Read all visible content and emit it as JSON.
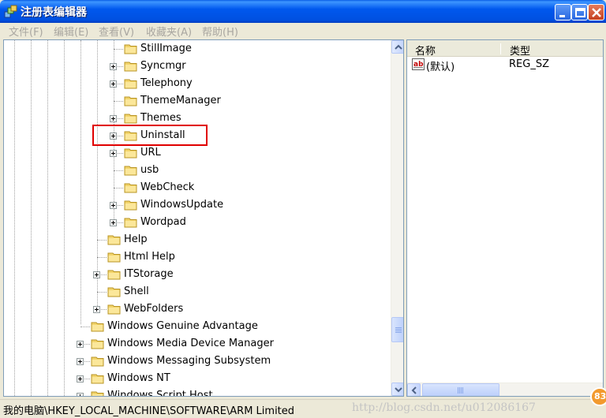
{
  "window": {
    "title": "注册表编辑器",
    "buttons": {
      "minimize": "minimize-icon",
      "maximize": "maximize-icon",
      "close": "close-icon"
    }
  },
  "menu": {
    "items": [
      {
        "label": "文件(F)"
      },
      {
        "label": "编辑(E)"
      },
      {
        "label": "查看(V)"
      },
      {
        "label": "收藏夹(A)"
      },
      {
        "label": "帮助(H)"
      }
    ]
  },
  "tree": {
    "nodes": [
      {
        "label": "StillImage",
        "expandable": false
      },
      {
        "label": "Syncmgr",
        "expandable": true
      },
      {
        "label": "Telephony",
        "expandable": true
      },
      {
        "label": "ThemeManager",
        "expandable": false
      },
      {
        "label": "Themes",
        "expandable": true
      },
      {
        "label": "Uninstall",
        "expandable": true,
        "highlighted": true
      },
      {
        "label": "URL",
        "expandable": true
      },
      {
        "label": "usb",
        "expandable": false
      },
      {
        "label": "WebCheck",
        "expandable": false
      },
      {
        "label": "WindowsUpdate",
        "expandable": true
      },
      {
        "label": "Wordpad",
        "expandable": true
      },
      {
        "label": "Help",
        "expandable": false
      },
      {
        "label": "Html Help",
        "expandable": false
      },
      {
        "label": "ITStorage",
        "expandable": true
      },
      {
        "label": "Shell",
        "expandable": false
      },
      {
        "label": "WebFolders",
        "expandable": true
      },
      {
        "label": "Windows Genuine Advantage",
        "expandable": false
      },
      {
        "label": "Windows Media Device Manager",
        "expandable": true
      },
      {
        "label": "Windows Messaging Subsystem",
        "expandable": true
      },
      {
        "label": "Windows NT",
        "expandable": true
      },
      {
        "label": "Windows Script Host",
        "expandable": true
      }
    ]
  },
  "list": {
    "columns": {
      "name": "名称",
      "type": "类型"
    },
    "rows": [
      {
        "name": "(默认)",
        "type": "REG_SZ",
        "icon": "string-value-icon"
      }
    ]
  },
  "status": {
    "path": "我的电脑\\HKEY_LOCAL_MACHINE\\SOFTWARE\\ARM Limited",
    "watermark": "http://blog.csdn.net/u012086167",
    "badge": "83"
  },
  "colors": {
    "titlebar": "#0058ee",
    "highlight_box": "#e00000",
    "window_bg": "#ece9d8"
  }
}
